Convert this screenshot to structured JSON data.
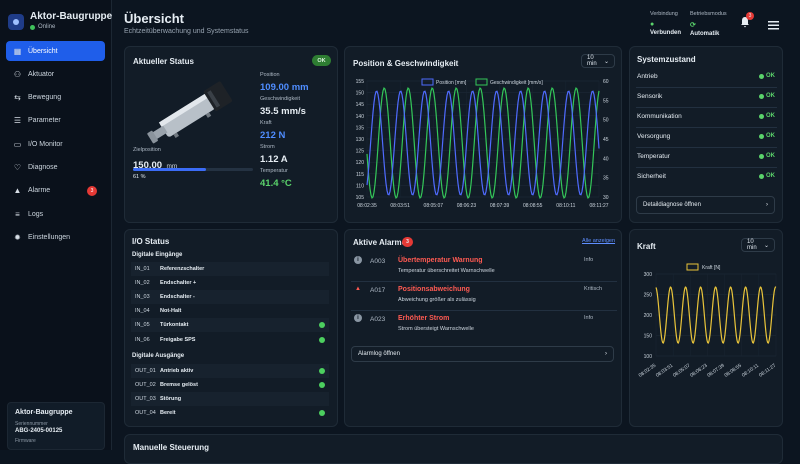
{
  "app": {
    "title": "Aktor-Baugruppe",
    "status": "Online"
  },
  "sidebar": {
    "items": [
      {
        "label": "Übersicht",
        "icon": "grid-icon",
        "active": true
      },
      {
        "label": "Aktuator",
        "icon": "nodes-icon"
      },
      {
        "label": "Bewegung",
        "icon": "move-icon"
      },
      {
        "label": "Parameter",
        "icon": "sliders-icon"
      },
      {
        "label": "I/O Monitor",
        "icon": "monitor-icon"
      },
      {
        "label": "Diagnose",
        "icon": "stethoscope-icon"
      },
      {
        "label": "Alarme",
        "icon": "warning-icon",
        "badge": "3"
      },
      {
        "label": "Logs",
        "icon": "list-icon"
      },
      {
        "label": "Einstellungen",
        "icon": "gear-icon"
      }
    ],
    "device": {
      "title": "Aktor-Baugruppe",
      "serial_label": "Seriennummer",
      "serial": "ABG-2405-00125",
      "firmware_label": "Firmware"
    }
  },
  "header": {
    "title": "Übersicht",
    "subtitle": "Echtzeitüberwachung und Systemstatus",
    "connection_label": "Verbindung",
    "connection_value": "Verbunden",
    "mode_label": "Betriebsmodus",
    "mode_value": "Automatik",
    "notifications": "3"
  },
  "status": {
    "title": "Aktueller Status",
    "badge": "OK",
    "position_label": "Position",
    "position_value": "109.00 mm",
    "speed_label": "Geschwindigkeit",
    "speed_value": "35.5 mm/s",
    "force_label": "Kraft",
    "force_value": "212 N",
    "current_label": "Strom",
    "current_value": "1.12 A",
    "temp_label": "Temperatur",
    "temp_value": "41.4 °C",
    "target_label": "Zielposition",
    "target_value": "150.00",
    "target_unit": "mm",
    "progress": 61,
    "progress_label": "61 %"
  },
  "pos_chart": {
    "title": "Position & Geschwindigkeit",
    "range": "10 min",
    "legend_pos": "Position [mm]",
    "legend_speed": "Geschwindigkeit [mm/s]",
    "y_left": [
      "155",
      "150",
      "145",
      "140",
      "135",
      "130",
      "125",
      "120",
      "115",
      "110",
      "105"
    ],
    "y_right": [
      "60",
      "55",
      "50",
      "45",
      "40",
      "35",
      "30"
    ],
    "x": [
      "08:02:35",
      "08:03:51",
      "08:05:07",
      "08:06:23",
      "08:07:39",
      "08:08:55",
      "08:10:11",
      "08:11:27"
    ]
  },
  "system": {
    "title": "Systemzustand",
    "items": [
      {
        "label": "Antrieb",
        "status": "OK"
      },
      {
        "label": "Sensorik",
        "status": "OK"
      },
      {
        "label": "Kommunikation",
        "status": "OK"
      },
      {
        "label": "Versorgung",
        "status": "OK"
      },
      {
        "label": "Temperatur",
        "status": "OK"
      },
      {
        "label": "Sicherheit",
        "status": "OK"
      }
    ],
    "button": "Detaildiagnose öffnen"
  },
  "io": {
    "title": "I/O Status",
    "inputs_title": "Digitale Eingänge",
    "outputs_title": "Digitale Ausgänge",
    "inputs": [
      {
        "id": "IN_01",
        "name": "Referenzschalter",
        "on": false
      },
      {
        "id": "IN_02",
        "name": "Endschalter +",
        "on": false
      },
      {
        "id": "IN_03",
        "name": "Endschalter -",
        "on": false
      },
      {
        "id": "IN_04",
        "name": "Not-Halt",
        "on": false
      },
      {
        "id": "IN_05",
        "name": "Türkontakt",
        "on": true
      },
      {
        "id": "IN_06",
        "name": "Freigabe SPS",
        "on": true
      }
    ],
    "outputs": [
      {
        "id": "OUT_01",
        "name": "Antrieb aktiv",
        "on": true
      },
      {
        "id": "OUT_02",
        "name": "Bremse gelöst",
        "on": true
      },
      {
        "id": "OUT_03",
        "name": "Störung",
        "on": false
      },
      {
        "id": "OUT_04",
        "name": "Bereit",
        "on": true
      }
    ]
  },
  "alarms": {
    "title": "Aktive Alarme",
    "count": "3",
    "show_all": "Alle anzeigen",
    "button": "Alarmlog öffnen",
    "items": [
      {
        "code": "A003",
        "title": "Übertemperatur Warnung",
        "desc": "Temperatur überschreitet Warnschwelle",
        "level": "Info",
        "icon": "info-icon"
      },
      {
        "code": "A017",
        "title": "Positionsabweichung",
        "desc": "Abweichung größer als zulässig",
        "level": "Kritisch",
        "icon": "warning-icon"
      },
      {
        "code": "A023",
        "title": "Erhöhter Strom",
        "desc": "Strom übersteigt Warnschwelle",
        "level": "Info",
        "icon": "info-icon"
      }
    ]
  },
  "force_chart": {
    "title": "Kraft",
    "range": "10 min",
    "legend": "Kraft [N]",
    "y": [
      "300",
      "250",
      "200",
      "150",
      "100"
    ],
    "x": [
      "08:02:35",
      "08:03:51",
      "08:05:07",
      "08:06:23",
      "08:07:39",
      "08:08:55",
      "08:10:11",
      "08:11:27"
    ]
  },
  "manual": {
    "title": "Manuelle Steuerung"
  },
  "colors": {
    "accent": "#1f5eea",
    "ok": "#5ad26b",
    "alarm": "#ff5a52",
    "position": "#4f6bff",
    "speed": "#34c759",
    "force": "#e9c43a"
  }
}
